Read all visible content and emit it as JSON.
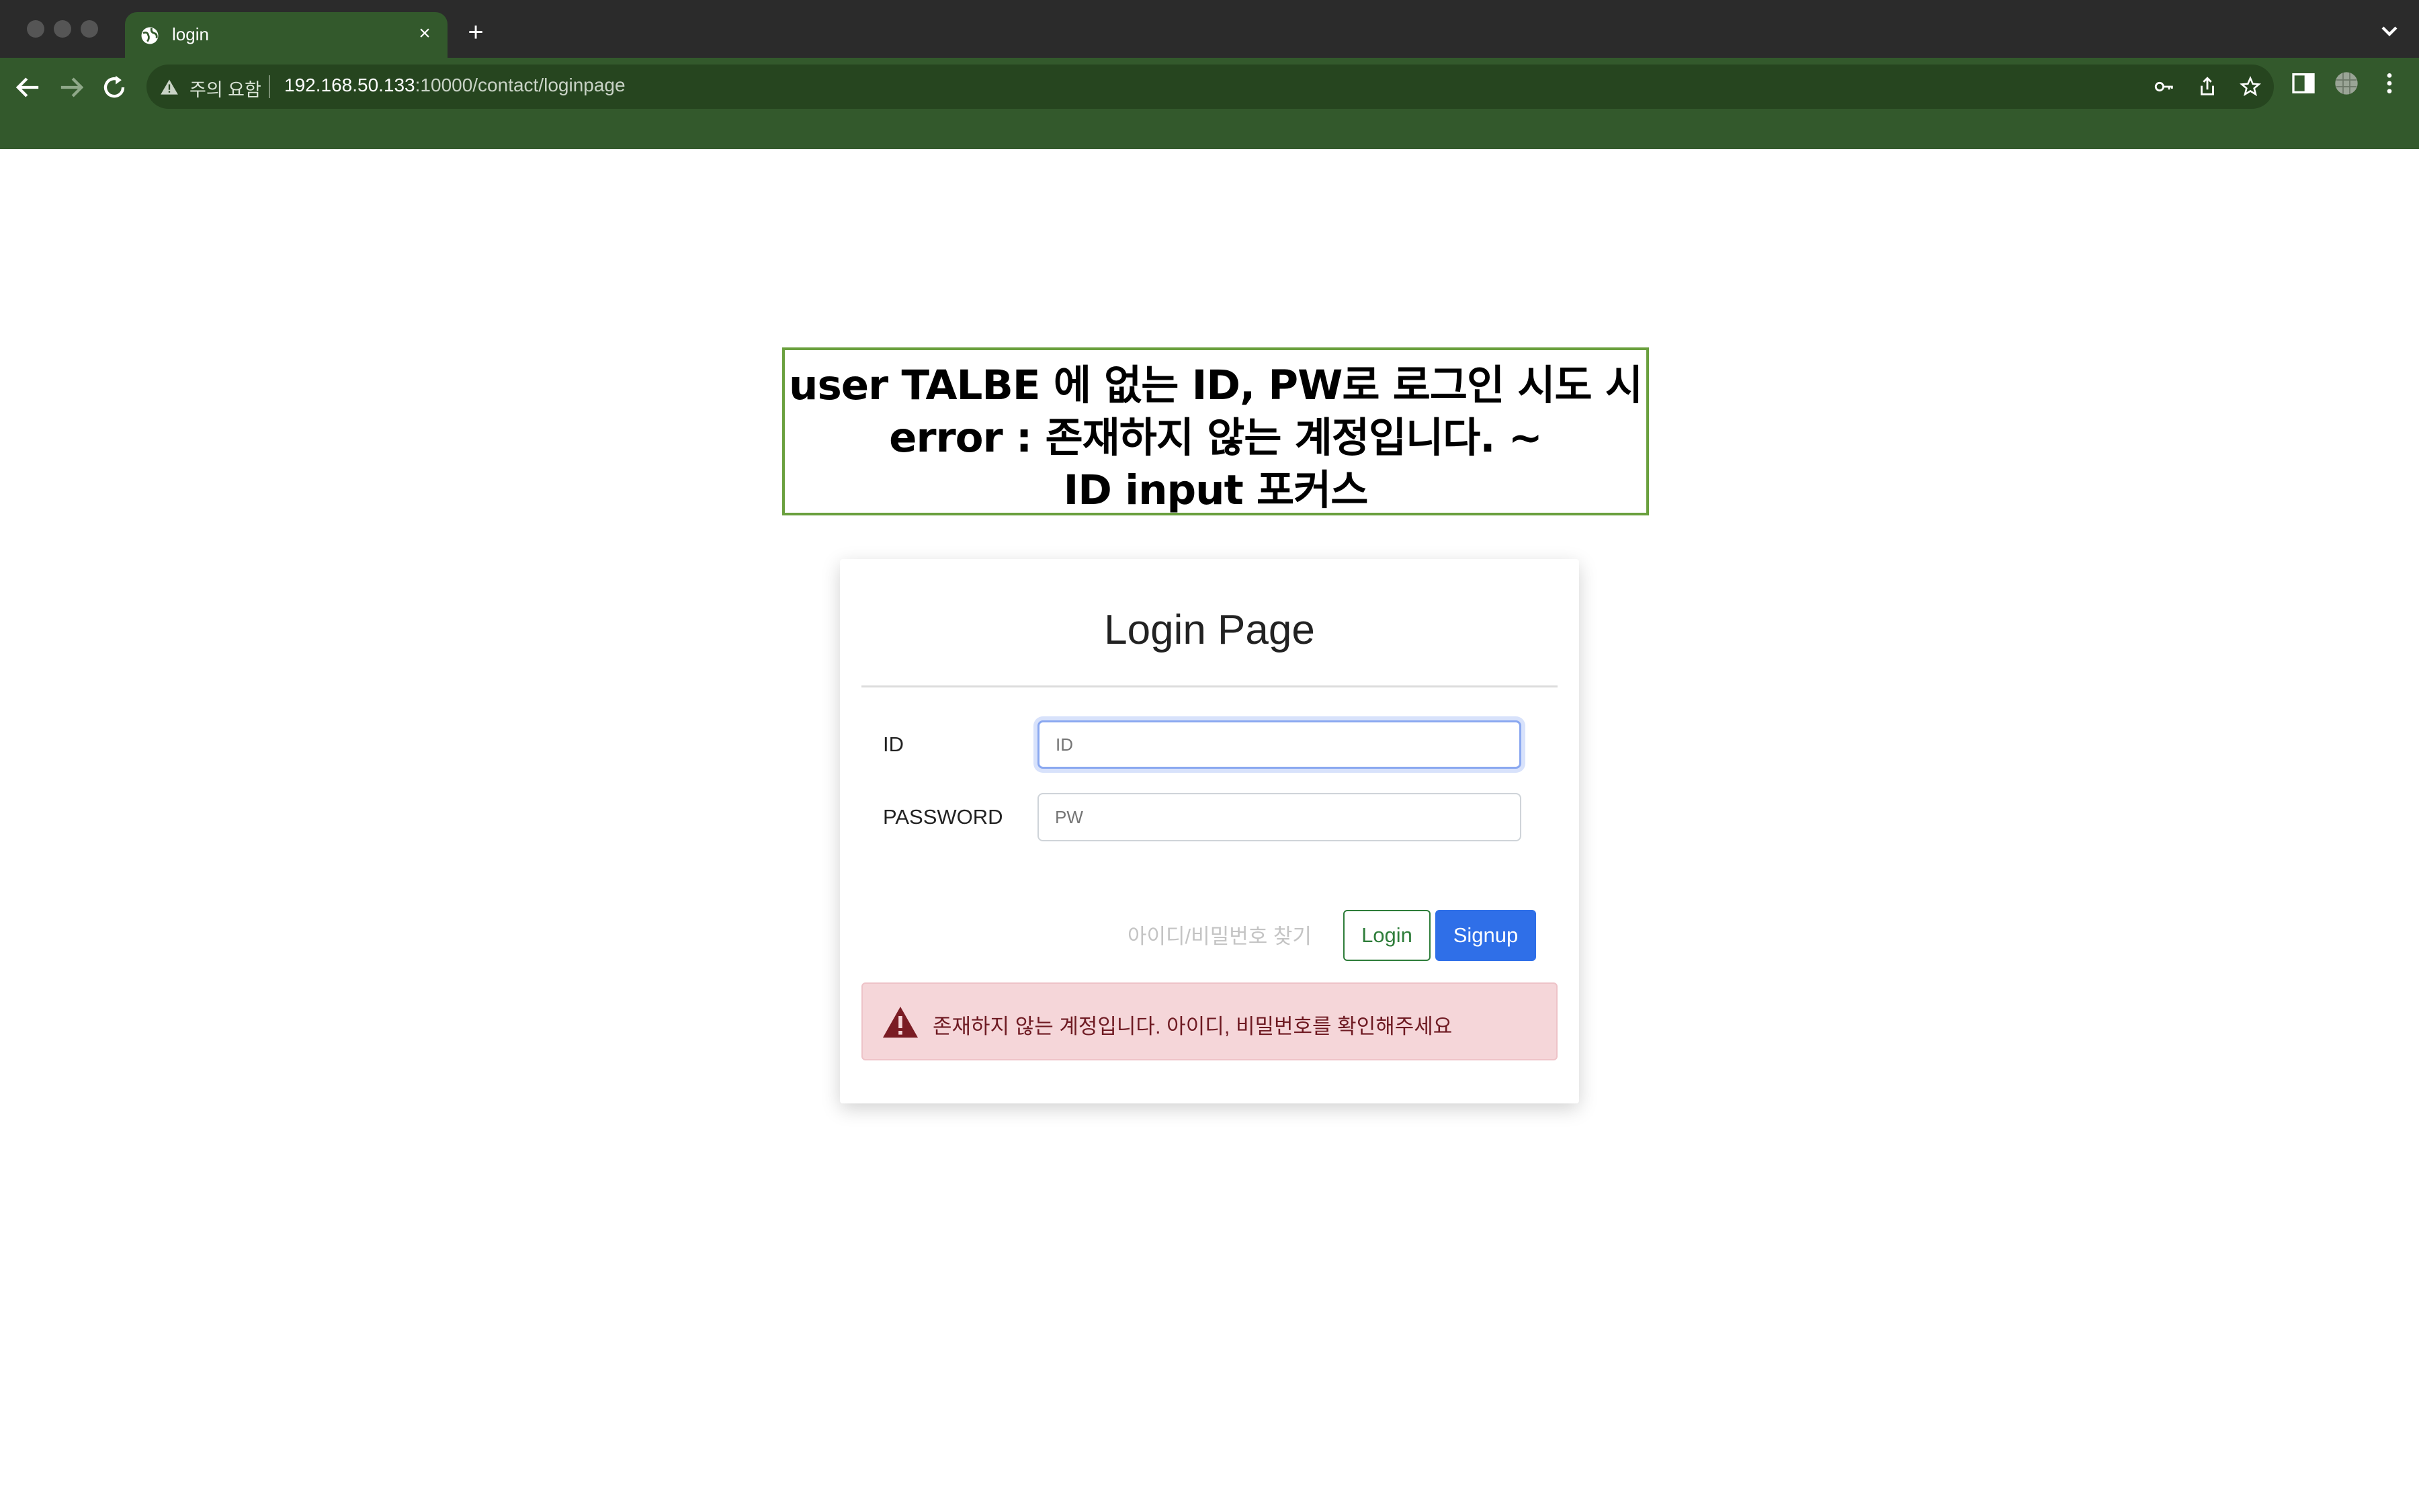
{
  "browser": {
    "tab_title": "login",
    "close_glyph": "×",
    "new_tab_glyph": "+",
    "security_label": "주의 요함",
    "url_host": "192.168.50.133",
    "url_path": ":10000/contact/loginpage"
  },
  "annotation": {
    "line1": "user TALBE 에 없는 ID, PW로 로그인 시도 시",
    "line2": "error : 존재하지 않는 계정입니다. ~",
    "line3": "ID input 포커스"
  },
  "login": {
    "title": "Login Page",
    "id_label": "ID",
    "id_placeholder": "ID",
    "pw_label": "PASSWORD",
    "pw_placeholder": "PW",
    "find_link": "아이디/비밀번호 찾기",
    "login_button": "Login",
    "signup_button": "Signup",
    "error_message": "존재하지 않는 계정입니다. 아이디, 비밀번호를 확인해주세요"
  },
  "colors": {
    "chrome_green": "#33592c",
    "annotation_border": "#6aa03e",
    "login_button": "#2e7d3a",
    "signup_button": "#2f6fe8",
    "alert_bg": "#f5d6d9",
    "alert_text": "#6e1a22"
  },
  "icons": [
    "globe-icon",
    "close-icon",
    "plus-icon",
    "chevron-down-icon",
    "back-icon",
    "forward-icon",
    "reload-icon",
    "warning-icon",
    "key-icon",
    "share-icon",
    "star-icon",
    "sidebar-icon",
    "profile-icon",
    "more-icon",
    "alert-triangle-icon"
  ]
}
